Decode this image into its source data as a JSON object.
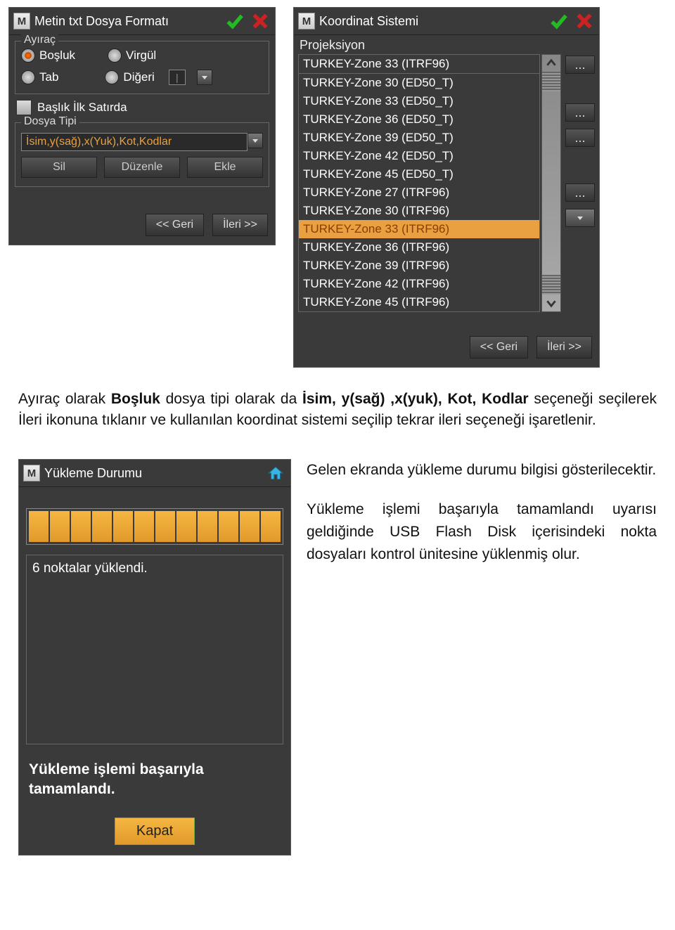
{
  "win1": {
    "title": "Metin txt Dosya Formatı",
    "fieldset1_legend": "Ayıraç",
    "radios": {
      "bosluk": "Boşluk",
      "virgul": "Virgül",
      "tab": "Tab",
      "digeri": "Diğeri"
    },
    "checkbox_label": "Başlık İlk Satırda",
    "fieldset2_legend": "Dosya Tipi",
    "select_value": "İsim,y(sağ),x(Yuk),Kot,Kodlar",
    "btn_sil": "Sil",
    "btn_duzenle": "Düzenle",
    "btn_ekle": "Ekle",
    "nav_back": "<< Geri",
    "nav_next": "İleri >>"
  },
  "win2": {
    "title": "Koordinat Sistemi",
    "proj_label": "Projeksiyon",
    "head_item": "TURKEY-Zone 33 (ITRF96)",
    "items": [
      "TURKEY-Zone 30 (ED50_T)",
      "TURKEY-Zone 33 (ED50_T)",
      "TURKEY-Zone 36 (ED50_T)",
      "TURKEY-Zone 39 (ED50_T)",
      "TURKEY-Zone 42 (ED50_T)",
      "TURKEY-Zone 45 (ED50_T)",
      "TURKEY-Zone 27 (ITRF96)",
      "TURKEY-Zone 30 (ITRF96)",
      "TURKEY-Zone 33 (ITRF96)",
      "TURKEY-Zone 36 (ITRF96)",
      "TURKEY-Zone 39 (ITRF96)",
      "TURKEY-Zone 42 (ITRF96)",
      "TURKEY-Zone 45 (ITRF96)"
    ],
    "selected_index": 8,
    "nav_back": "<< Geri",
    "nav_next": "İleri >>",
    "ellipsis": "..."
  },
  "paragraph": {
    "pre": "Ayıraç olarak ",
    "b1": "Boşluk",
    "mid1": " dosya tipi olarak  da  ",
    "b2": "İsim, y(sağ) ,x(yuk), Kot, Kodlar",
    "mid2": "  seçeneği seçilerek İleri ikonuna tıklanır ve kullanılan koordinat sistemi seçilip tekrar ileri seçeneği işaretlenir."
  },
  "win3": {
    "title": "Yükleme Durumu",
    "progress_segments": 12,
    "msg": "6 noktalar yüklendi.",
    "done": "Yükleme işlemi başarıyla tamamlandı.",
    "close": "Kapat"
  },
  "side": {
    "p1": "Gelen ekranda yükleme durumu bilgisi gösterilecektir.",
    "p2": "Yükleme işlemi başarıyla tamamlandı uyarısı geldiğinde USB Flash Disk içerisindeki nokta dosyaları kontrol ünitesine yüklenmiş olur."
  }
}
